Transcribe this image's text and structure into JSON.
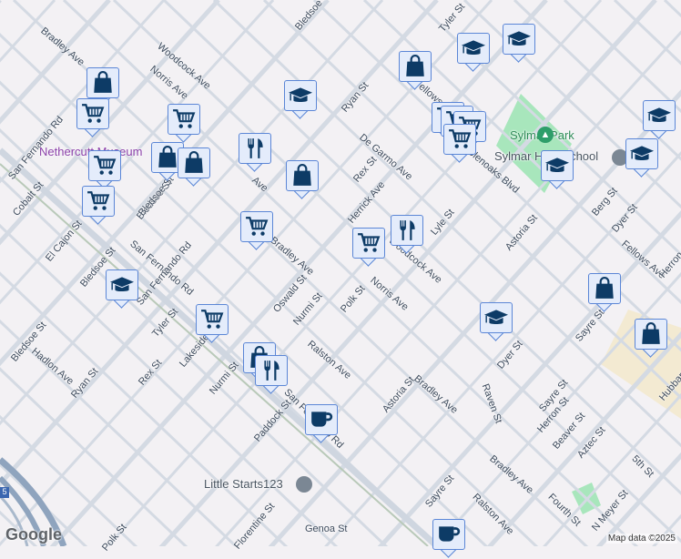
{
  "colors": {
    "background": "#f3f1f4",
    "road": "#d4dae3",
    "freeway": "#8fa4be",
    "park": "#a8e6bc",
    "school_area": "#f3ead2",
    "marker_fill": "#e4ecfb",
    "marker_border": "#5b86d6",
    "icon": "#0d3b66",
    "museum": "#8a3fa8",
    "park_label": "#2e8b57"
  },
  "labels": [
    "Bradley Ave",
    "Woodcock Ave",
    "Norris Ave",
    "Bledsoe St",
    "Tyler St",
    "Ryan St",
    "De Garmo Ave",
    "Rex St",
    "Herrick Ave",
    "Glenoaks Blvd",
    "Lyle St",
    "Astoria St",
    "Berg St",
    "Dyer St",
    "Fellows Ave",
    "Sayre St",
    "Herron St",
    "Hubbard St",
    "Cobalt St",
    "El Cajon St",
    "San Fernando Rd",
    "Bledsoe St",
    "Bradley Ave",
    "Polk St",
    "Norris Ave",
    "Woodcock Ave",
    "Oswald St",
    "Nurmi St",
    "San Fernando Rd",
    "San Fernando Rd",
    "Bledsoe St",
    "Tyler St",
    "Lakeside St",
    "Rex St",
    "Ryan St",
    "Hadlon Ave",
    "Bledsoe St",
    "Nurmi St",
    "Ralston Ave",
    "Astoria St",
    "Bradley Ave",
    "Dyer St",
    "Raven St",
    "Sayre St",
    "Herron St",
    "Beaver St",
    "Aztec St",
    "5th St",
    "Bradley Ave",
    "Fourth St",
    "N Meyer St",
    "Paddock St",
    "San Fernando Rd",
    "Sayre St",
    "Ralston Ave",
    "Florentine St",
    "Genoa St",
    "Polk St",
    "Fellows Ave",
    "Ave",
    "Bledsoe St"
  ],
  "pois": {
    "park": "Sylmar Park",
    "school": "Sylmar High School",
    "museum": "Nethercutt Museum",
    "place": "Little Starts123"
  },
  "markers": [
    "graduation-cap",
    "graduation-cap",
    "shopping-bag",
    "shopping-bag",
    "shopping-cart",
    "shopping-cart",
    "graduation-cap",
    "shopping-cart",
    "shopping-cart",
    "shopping-cart",
    "shopping-cart",
    "graduation-cap",
    "graduation-cap",
    "graduation-cap",
    "restaurant",
    "shopping-bag",
    "shopping-bag",
    "shopping-cart",
    "shopping-cart",
    "shopping-bag",
    "shopping-cart",
    "shopping-cart",
    "restaurant",
    "shopping-bag",
    "graduation-cap",
    "shopping-bag",
    "graduation-cap",
    "shopping-cart",
    "shopping-bag",
    "restaurant",
    "coffee",
    "coffee"
  ],
  "shield": "5",
  "logo": "Google",
  "attribution": "Map data ©2025"
}
